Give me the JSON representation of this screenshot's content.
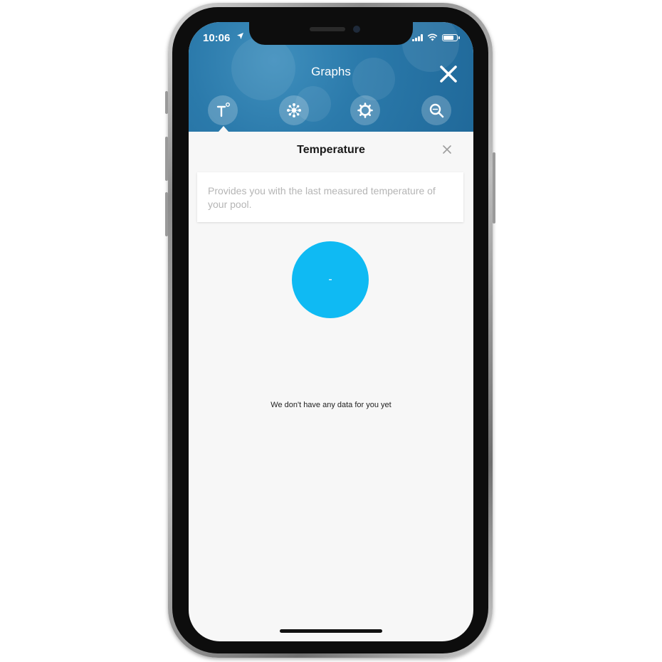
{
  "status_bar": {
    "time": "10:06",
    "location_icon": "location-arrow-icon",
    "signal_icon": "cellular-signal-icon",
    "wifi_icon": "wifi-icon",
    "battery_icon": "battery-icon"
  },
  "header": {
    "title": "Graphs",
    "close_icon": "close-icon",
    "background_color": "#2b7aab"
  },
  "tabs": [
    {
      "id": "temperature",
      "icon": "temperature-icon",
      "active": true
    },
    {
      "id": "chlorine",
      "icon": "molecule-icon",
      "active": false
    },
    {
      "id": "settings",
      "icon": "gear-icon",
      "active": false
    },
    {
      "id": "search",
      "icon": "magnifier-icon",
      "active": false
    }
  ],
  "panel": {
    "title": "Temperature",
    "close_icon": "close-icon",
    "description": "Provides you with the last measured temperature of your pool.",
    "value": "-",
    "value_color": "#0fbaf3",
    "empty_message": "We don't have any data for you yet"
  }
}
